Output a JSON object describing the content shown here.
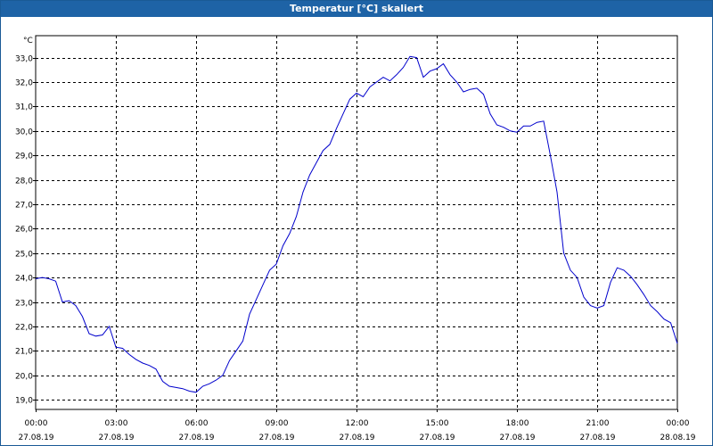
{
  "window": {
    "title": "Temperatur [°C] skaliert"
  },
  "colors": {
    "titlebar": "#1e63a6",
    "series": "#0000cc",
    "grid": "#000000"
  },
  "chart_data": {
    "type": "line",
    "title": "Temperatur [°C] skaliert",
    "ylabel": "°C",
    "xlabel": "",
    "ylim": [
      18.6,
      33.9
    ],
    "yticks": [
      19.0,
      20.0,
      21.0,
      22.0,
      23.0,
      24.0,
      25.0,
      26.0,
      27.0,
      28.0,
      29.0,
      30.0,
      31.0,
      32.0,
      33.0
    ],
    "ytick_labels": [
      "19,0",
      "20,0",
      "21,0",
      "22,0",
      "23,0",
      "24,0",
      "25,0",
      "26,0",
      "27,0",
      "28,0",
      "29,0",
      "30,0",
      "31,0",
      "32,0",
      "33,0"
    ],
    "xlim": [
      0,
      24
    ],
    "xticks": [
      0,
      3,
      6,
      9,
      12,
      15,
      18,
      21,
      24
    ],
    "xtick_labels": [
      {
        "time": "00:00",
        "date": "27.08.19"
      },
      {
        "time": "03:00",
        "date": "27.08.19"
      },
      {
        "time": "06:00",
        "date": "27.08.19"
      },
      {
        "time": "09:00",
        "date": "27.08.19"
      },
      {
        "time": "12:00",
        "date": "27.08.19"
      },
      {
        "time": "15:00",
        "date": "27.08.19"
      },
      {
        "time": "18:00",
        "date": "27.08.19"
      },
      {
        "time": "21:00",
        "date": "27.08.19"
      },
      {
        "time": "00:00",
        "date": "28.08.19"
      }
    ],
    "grid": true,
    "x": [
      0.0,
      0.25,
      0.5,
      0.75,
      1.0,
      1.25,
      1.5,
      1.75,
      2.0,
      2.25,
      2.5,
      2.75,
      3.0,
      3.25,
      3.5,
      3.75,
      4.0,
      4.25,
      4.5,
      4.75,
      5.0,
      5.25,
      5.5,
      5.75,
      6.0,
      6.25,
      6.5,
      6.75,
      7.0,
      7.25,
      7.5,
      7.75,
      8.0,
      8.25,
      8.5,
      8.75,
      9.0,
      9.25,
      9.5,
      9.75,
      10.0,
      10.25,
      10.5,
      10.75,
      11.0,
      11.25,
      11.5,
      11.75,
      12.0,
      12.25,
      12.5,
      12.75,
      13.0,
      13.25,
      13.5,
      13.75,
      14.0,
      14.25,
      14.5,
      14.75,
      15.0,
      15.25,
      15.5,
      15.75,
      16.0,
      16.25,
      16.5,
      16.75,
      17.0,
      17.25,
      17.5,
      17.75,
      18.0,
      18.25,
      18.5,
      18.75,
      19.0,
      19.25,
      19.5,
      19.75,
      20.0,
      20.25,
      20.5,
      20.75,
      21.0,
      21.25,
      21.5,
      21.75,
      22.0,
      22.25,
      22.5,
      22.75,
      23.0,
      23.25,
      23.5,
      23.75,
      24.0
    ],
    "series": [
      {
        "values": [
          23.95,
          24.0,
          23.95,
          23.85,
          23.0,
          23.05,
          22.85,
          22.4,
          21.7,
          21.6,
          21.65,
          22.0,
          21.15,
          21.1,
          20.85,
          20.65,
          20.5,
          20.4,
          20.25,
          19.75,
          19.55,
          19.5,
          19.45,
          19.35,
          19.3,
          19.55,
          19.65,
          19.8,
          20.0,
          20.6,
          21.0,
          21.4,
          22.5,
          23.1,
          23.7,
          24.3,
          24.55,
          25.3,
          25.8,
          26.5,
          27.5,
          28.2,
          28.7,
          29.2,
          29.45,
          30.1,
          30.7,
          31.3,
          31.55,
          31.4,
          31.8,
          32.0,
          32.2,
          32.05,
          32.3,
          32.6,
          33.05,
          33.0,
          32.2,
          32.45,
          32.55,
          32.75,
          32.3,
          32.0,
          31.6,
          31.7,
          31.75,
          31.5,
          30.7,
          30.25,
          30.15,
          30.0,
          29.95,
          30.2,
          30.2,
          30.35,
          30.4,
          29.0,
          27.5,
          25.0,
          24.3,
          24.0,
          23.2,
          22.85,
          22.75,
          22.85,
          23.8,
          24.4,
          24.3,
          24.05,
          23.7,
          23.3,
          22.85,
          22.6,
          22.3,
          22.15,
          21.3
        ]
      }
    ]
  }
}
